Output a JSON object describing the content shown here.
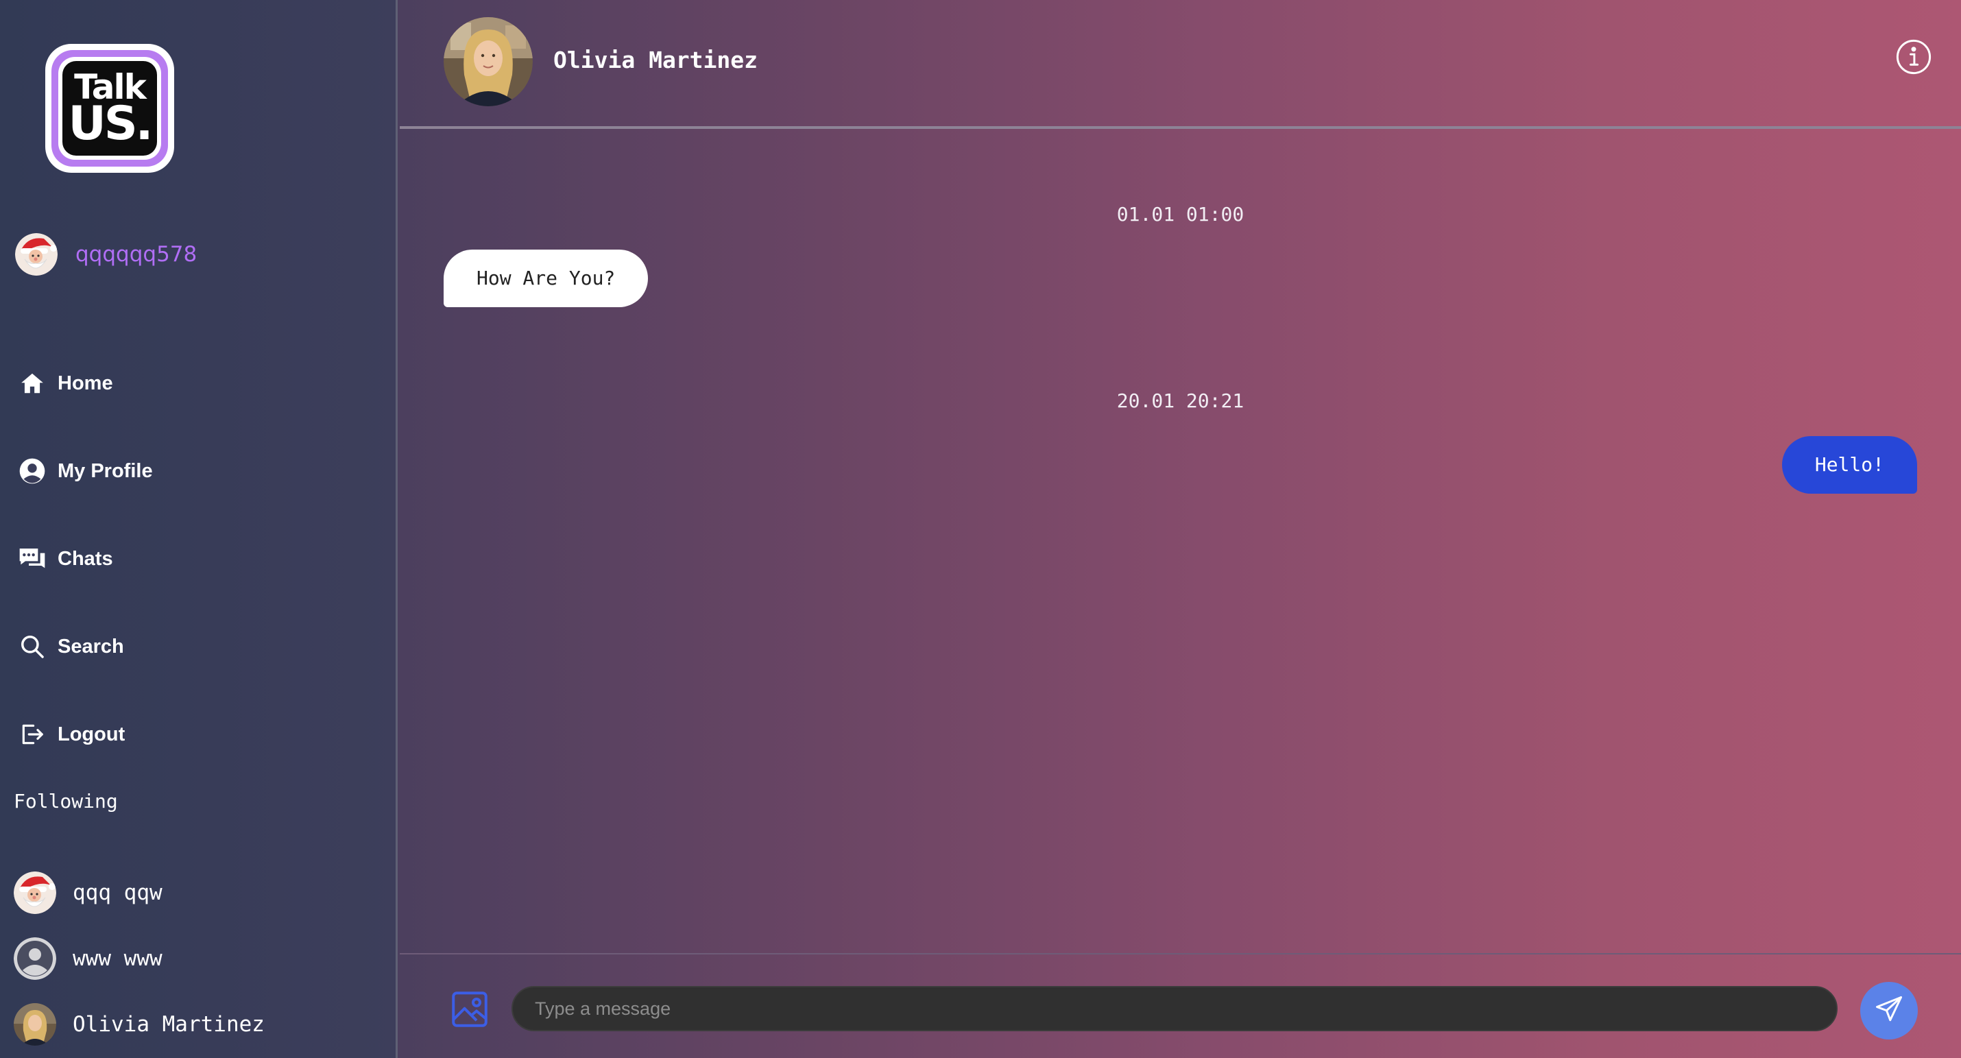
{
  "brand": {
    "logo_line1": "Talk",
    "logo_line2": "US."
  },
  "current_user": {
    "username": "qqqqqq578",
    "avatar": "santa-avatar"
  },
  "nav": {
    "items": [
      {
        "label": "Home",
        "icon": "home-icon"
      },
      {
        "label": "My Profile",
        "icon": "profile-icon"
      },
      {
        "label": "Chats",
        "icon": "chats-icon"
      },
      {
        "label": "Search",
        "icon": "search-icon"
      },
      {
        "label": "Logout",
        "icon": "logout-icon"
      }
    ]
  },
  "following": {
    "title": "Following",
    "users": [
      {
        "name": "qqq qqw",
        "avatar": "santa-avatar"
      },
      {
        "name": "www www",
        "avatar": "default-avatar"
      },
      {
        "name": "Olivia Martinez",
        "avatar": "photo-avatar"
      }
    ]
  },
  "chat": {
    "contact_name": "Olivia Martinez",
    "messages": [
      {
        "timestamp": "01.01 01:00",
        "text": "How Are You?",
        "direction": "incoming"
      },
      {
        "timestamp": "20.01 20:21",
        "text": "Hello!",
        "direction": "outgoing"
      }
    ]
  },
  "composer": {
    "placeholder": "Type a message",
    "value": ""
  },
  "colors": {
    "accent_username": "#b06ef5",
    "outgoing_bubble": "#2747d8",
    "send_button": "#5b82e8",
    "logo_ring": "#b77cf0"
  }
}
